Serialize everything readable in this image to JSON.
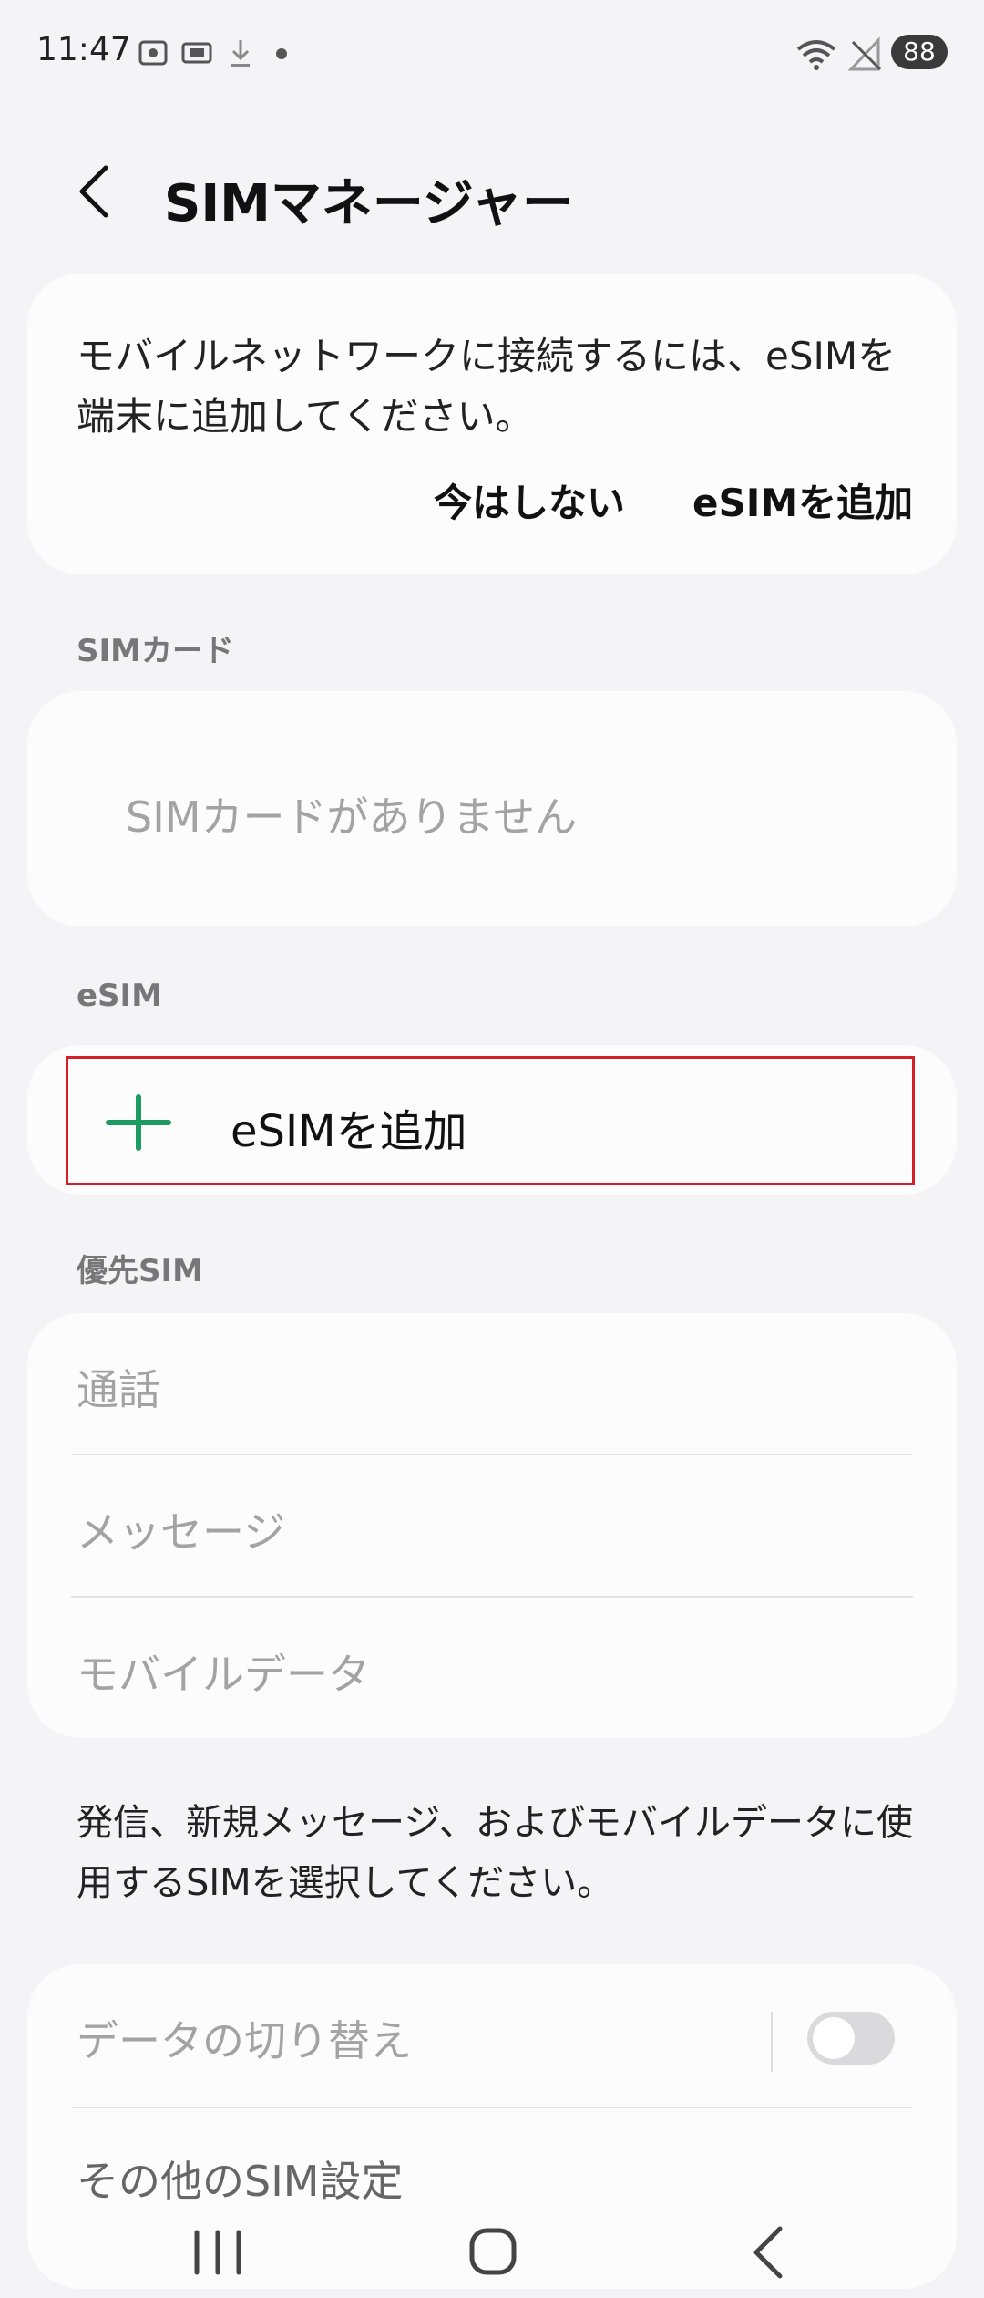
{
  "status_bar": {
    "time": "11:47",
    "battery": "88",
    "icons": [
      "screenshot-icon",
      "screen-record-icon",
      "download-icon",
      "dot-icon",
      "wifi-icon",
      "no-signal-icon"
    ]
  },
  "header": {
    "title": "SIMマネージャー"
  },
  "notice": {
    "message": "モバイルネットワークに接続するには、eSIMを端末に追加してください。",
    "dismiss_label": "今はしない",
    "add_label": "eSIMを追加"
  },
  "sim_section": {
    "label": "SIMカード",
    "empty_text": "SIMカードがありません"
  },
  "esim_section": {
    "label": "eSIM",
    "add_label": "eSIMを追加",
    "accent": "#1e9a63"
  },
  "preferred_section": {
    "label": "優先SIM",
    "items": [
      "通話",
      "メッセージ",
      "モバイルデータ"
    ],
    "note": "発信、新規メッセージ、およびモバイルデータに使用するSIMを選択してください。"
  },
  "settings": {
    "data_switch_label": "データの切り替え",
    "data_switch_on": false,
    "more_settings_label": "その他のSIM設定"
  },
  "nav": {
    "icons": [
      "recent-apps-icon",
      "home-icon",
      "back-nav-icon"
    ]
  }
}
